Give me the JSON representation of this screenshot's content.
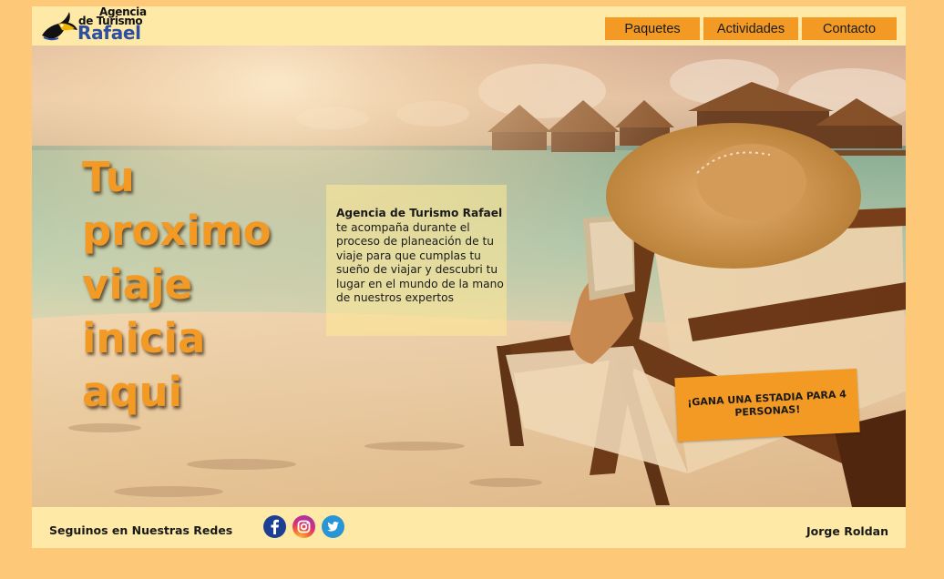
{
  "brand": {
    "line1": "Agencia",
    "line2": "de Turismo",
    "line3": "Rafael"
  },
  "nav": {
    "items": [
      {
        "label": "Paquetes"
      },
      {
        "label": "Actividades"
      },
      {
        "label": "Contacto"
      }
    ]
  },
  "hero": {
    "headline": [
      "Tu",
      "proximo",
      "viaje",
      "inicia",
      "aqui"
    ],
    "info_bold": "Agencia de Turismo Rafael",
    "info_text": " te acompaña durante el proceso de planeación de tu viaje para que cumplas tu sueño de viajar y descubri tu lugar en el mundo de la mano de nuestros expertos",
    "promo_label": "¡GANA UNA ESTADIA PARA 4 PERSONAS!"
  },
  "footer": {
    "follow_label": "Seguinos en Nuestras Redes",
    "socials": [
      "facebook-icon",
      "instagram-icon",
      "twitter-icon"
    ],
    "author": "Jorge Roldan"
  },
  "colors": {
    "page_bg": "#fdc878",
    "panel_bg": "#ffe9a6",
    "accent": "#f39a24",
    "brand_blue": "#2e4fa0"
  }
}
